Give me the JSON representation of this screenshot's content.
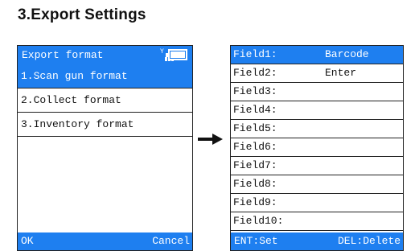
{
  "heading": {
    "number": "3",
    "text": ".Export Settings"
  },
  "left_screen": {
    "title": "Export format",
    "status": {
      "signal_icon": "signal-bars-icon",
      "battery_icon": "battery-icon"
    },
    "items": [
      {
        "label": "1.Scan gun format",
        "selected": true
      },
      {
        "label": "2.Collect format",
        "selected": false
      },
      {
        "label": "3.Inventory format",
        "selected": false
      }
    ],
    "footer": {
      "left": "OK",
      "right": "Cancel"
    }
  },
  "arrow_icon": "right-arrow-icon",
  "right_screen": {
    "fields": [
      {
        "label": "Field1:",
        "value": "Barcode",
        "selected": true
      },
      {
        "label": "Field2:",
        "value": "Enter",
        "selected": false
      },
      {
        "label": "Field3:",
        "value": "",
        "selected": false
      },
      {
        "label": "Field4:",
        "value": "",
        "selected": false
      },
      {
        "label": "Field5:",
        "value": "",
        "selected": false
      },
      {
        "label": "Field6:",
        "value": "",
        "selected": false
      },
      {
        "label": "Field7:",
        "value": "",
        "selected": false
      },
      {
        "label": "Field8:",
        "value": "",
        "selected": false
      },
      {
        "label": "Field9:",
        "value": "",
        "selected": false
      },
      {
        "label": "Field10:",
        "value": "",
        "selected": false
      }
    ],
    "footer": {
      "left": "ENT:Set",
      "right": "DEL:Delete"
    }
  },
  "colors": {
    "accent": "#1e7ff0",
    "text": "#111111",
    "background": "#ffffff"
  }
}
